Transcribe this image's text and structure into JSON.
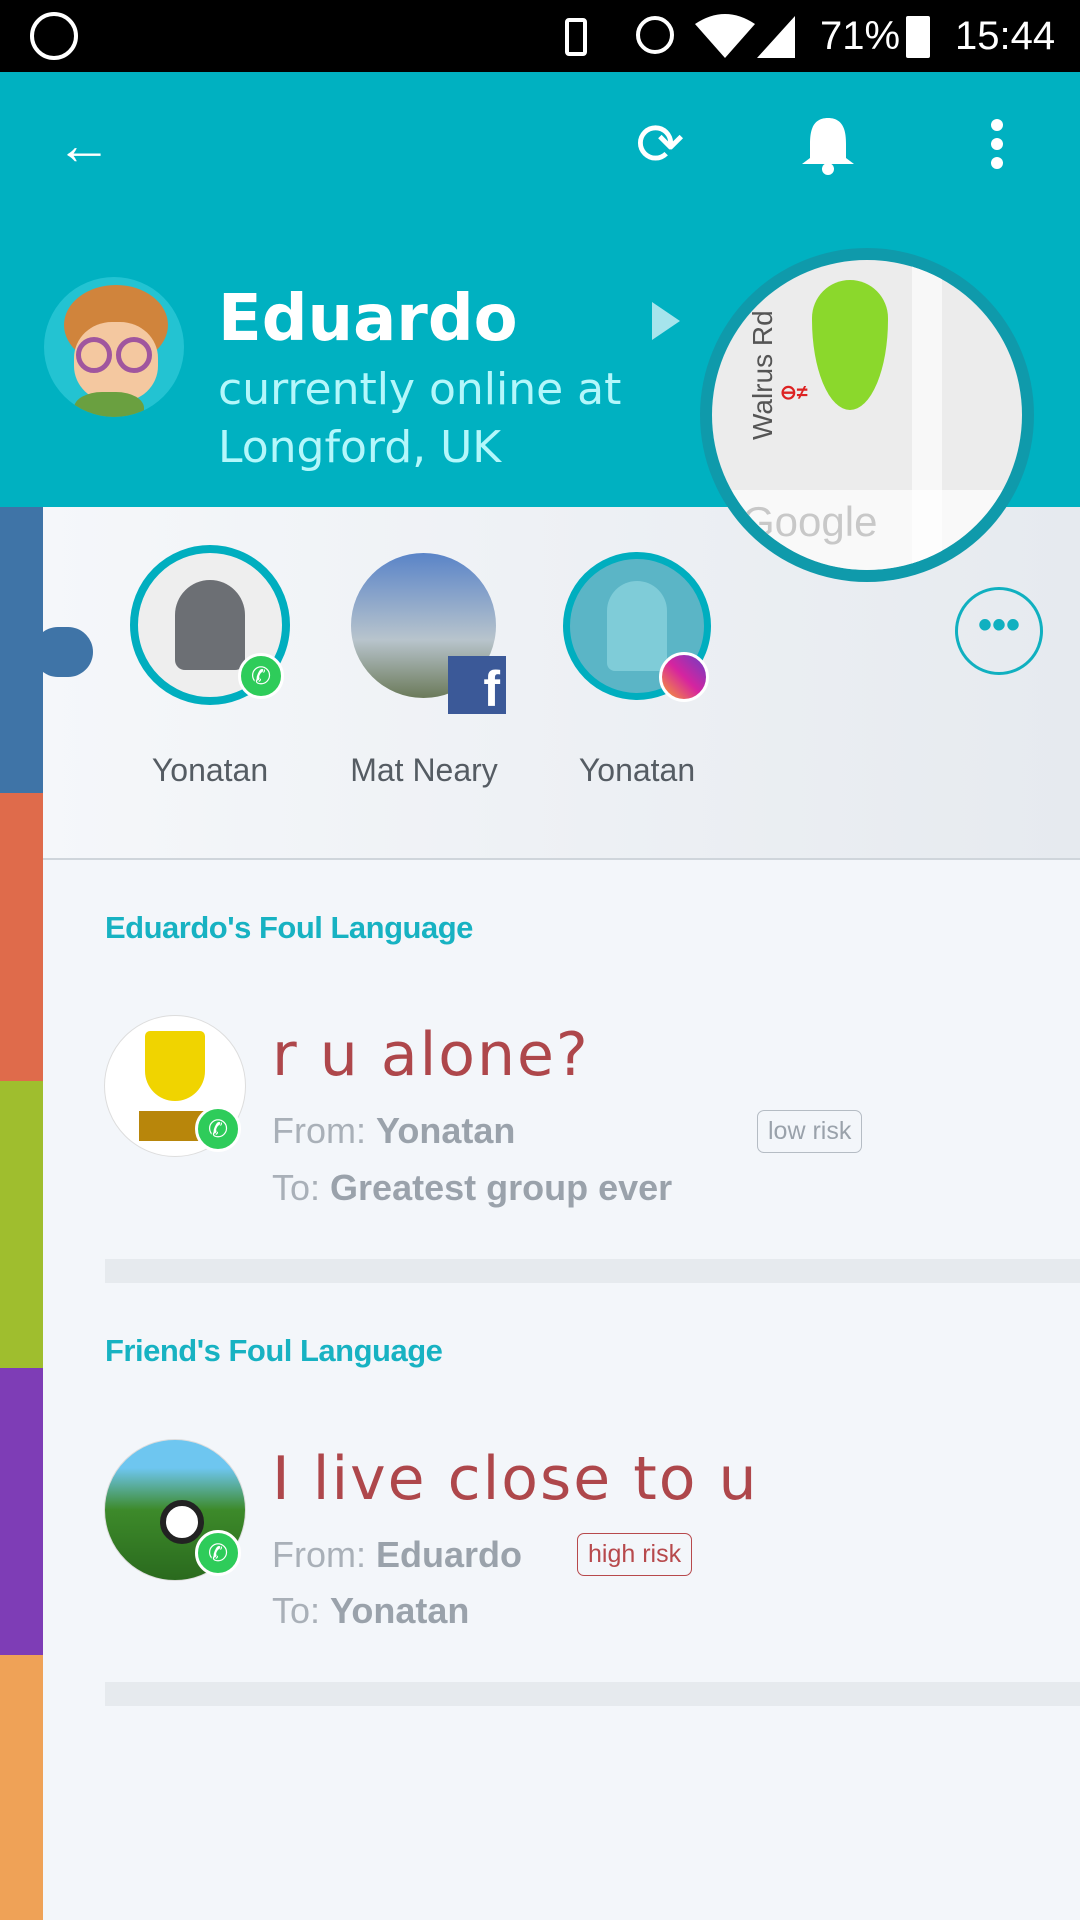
{
  "status_bar": {
    "battery": "71%",
    "time": "15:44",
    "icons": [
      "whatsapp-icon",
      "vibrate-icon",
      "alarm-icon",
      "wifi-icon",
      "signal-icon",
      "battery-icon"
    ]
  },
  "toolbar": {
    "icons": [
      "back-arrow-icon",
      "refresh-icon",
      "bell-icon",
      "more-vert-icon"
    ]
  },
  "profile": {
    "name": "Eduardo",
    "status_line1": "currently online at",
    "status_line2": "Longford, UK",
    "map_street": "Walrus Rd",
    "map_logo": "Google"
  },
  "contacts": [
    {
      "name": "Yonatan",
      "app": "whatsapp"
    },
    {
      "name": "Mat Neary",
      "app": "facebook"
    },
    {
      "name": "Yonatan",
      "app": "instagram"
    }
  ],
  "side_colors": [
    "#3f74a7",
    "#df6b4b",
    "#9fbe2e",
    "#7e3db6",
    "#efa257"
  ],
  "sections": [
    {
      "title": "Eduardo's Foul Language",
      "item": {
        "message": "r u alone?",
        "from_label": "From:",
        "from": "Yonatan",
        "to_label": "To:",
        "to": "Greatest group ever",
        "risk": "low risk"
      }
    },
    {
      "title": "Friend's Foul Language",
      "item": {
        "message": "I live close to u",
        "from_label": "From:",
        "from": "Eduardo",
        "to_label": "To:",
        "to": "Yonatan",
        "risk": "high risk"
      }
    }
  ]
}
